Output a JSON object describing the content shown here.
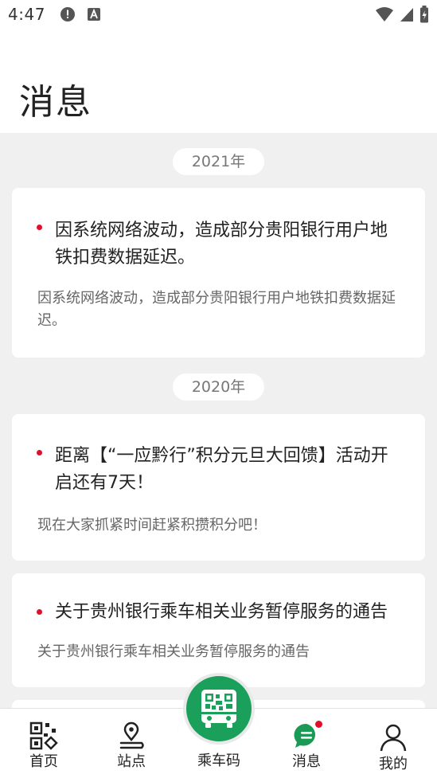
{
  "status_bar": {
    "time": "4:47"
  },
  "header": {
    "title": "消息"
  },
  "messages": [
    {
      "year": "2021年",
      "items": [
        {
          "title": "因系统网络波动，造成部分贵阳银行用户地铁扣费数据延迟。",
          "description": "因系统网络波动，造成部分贵阳银行用户地铁扣费数据延迟。"
        }
      ]
    },
    {
      "year": "2020年",
      "items": [
        {
          "title": "距离【“一应黔行”积分元旦大回馈】活动开启还有7天！",
          "description": "现在大家抓紧时间赶紧积攒积分吧！"
        },
        {
          "title": "关于贵州银行乘车相关业务暂停服务的通告",
          "description": "关于贵州银行乘车相关业务暂停服务的通告"
        }
      ]
    }
  ],
  "bottom_nav": {
    "items": [
      {
        "label": "首页",
        "icon": "home-qr-icon",
        "active": false
      },
      {
        "label": "站点",
        "icon": "location-pin-icon",
        "active": false
      },
      {
        "label": "乘车码",
        "icon": "bus-qr-code-icon",
        "active": false
      },
      {
        "label": "消息",
        "icon": "message-bubble-icon",
        "active": true
      },
      {
        "label": "我的",
        "icon": "user-icon",
        "active": false
      }
    ]
  },
  "colors": {
    "accent": "#1aa05a",
    "badge": "#e0102a",
    "background": "#f0f0f0"
  }
}
